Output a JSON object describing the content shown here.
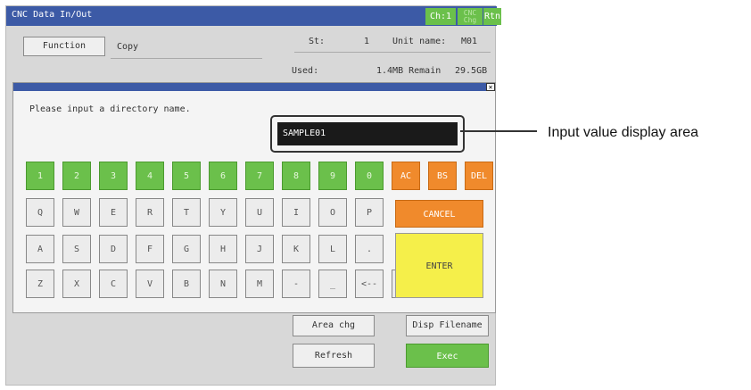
{
  "window": {
    "title": "CNC Data In/Out",
    "ch_label": "Ch:1",
    "cnc_chg_label": "CNC Chg",
    "rtn_label": "Rtn"
  },
  "header": {
    "function_label": "Function",
    "function_value": "Copy",
    "st_label": "St:",
    "st_value": "1",
    "unit_name_label": "Unit name:",
    "unit_name_value": "M01",
    "used_label": "Used:",
    "used_value": "1.4MB Remain",
    "remain_value": "29.5GB"
  },
  "dialog": {
    "prompt": "Please input a directory name.",
    "input_value": "SAMPLE01",
    "close_icon": "close-icon",
    "keys": {
      "row1": [
        "1",
        "2",
        "3",
        "4",
        "5",
        "6",
        "7",
        "8",
        "9",
        "0"
      ],
      "row1_ctl": [
        "AC",
        "BS",
        "DEL"
      ],
      "row2": [
        "Q",
        "W",
        "E",
        "R",
        "T",
        "Y",
        "U",
        "I",
        "O",
        "P"
      ],
      "row3": [
        "A",
        "S",
        "D",
        "F",
        "G",
        "H",
        "J",
        "K",
        "L",
        "."
      ],
      "row4": [
        "Z",
        "X",
        "C",
        "V",
        "B",
        "N",
        "M",
        "-",
        "_",
        "<--",
        "-->"
      ]
    },
    "cancel_label": "CANCEL",
    "enter_label": "ENTER"
  },
  "bottom": {
    "area_chg_label": "Area chg",
    "disp_filename_label": "Disp Filename",
    "refresh_label": "Refresh",
    "exec_label": "Exec"
  },
  "callout": {
    "text": "Input value display area"
  },
  "colors": {
    "titlebar": "#3c5aa6",
    "green": "#6bc04b",
    "orange": "#f08a2c",
    "yellow": "#f5ef4a"
  }
}
